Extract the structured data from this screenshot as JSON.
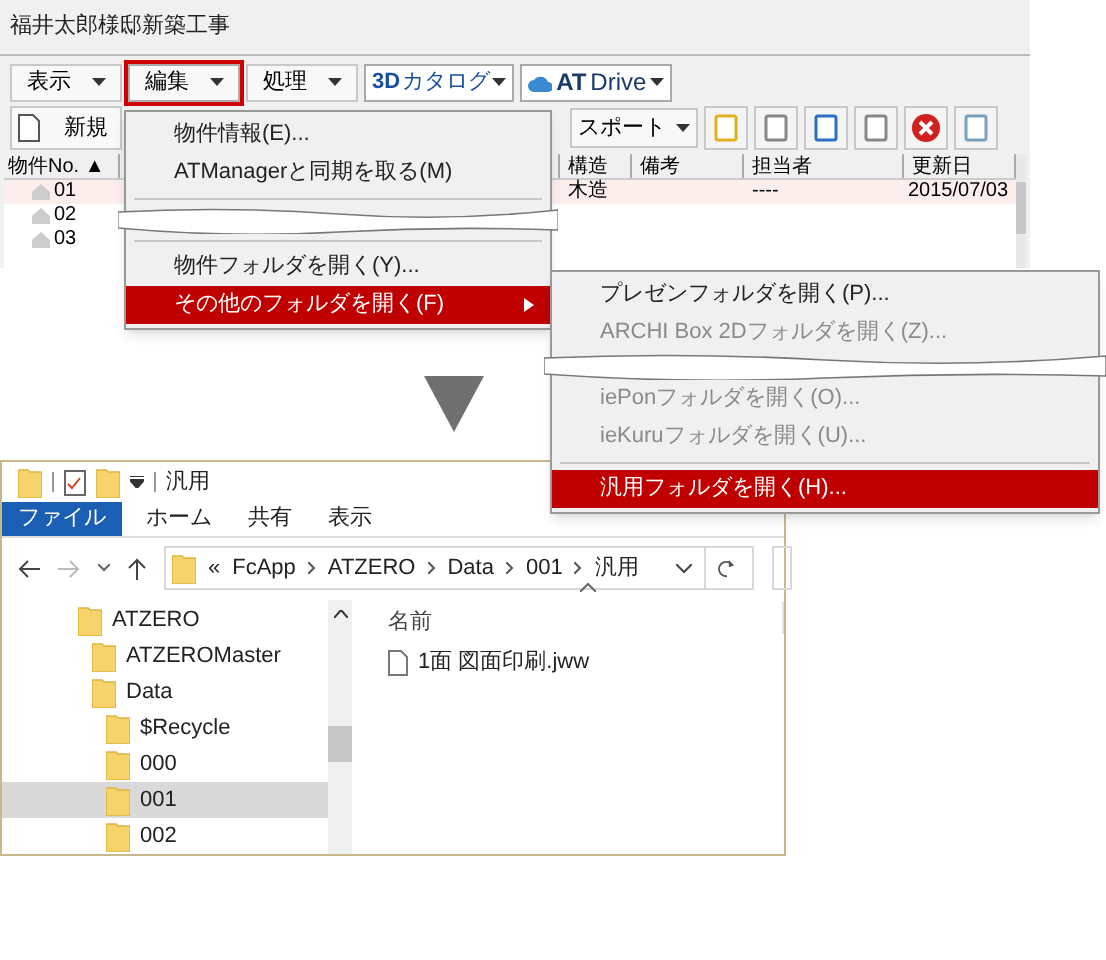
{
  "app": {
    "title": "福井太郎様邸新築工事",
    "menu_bar": [
      {
        "label": "表示",
        "selected": false
      },
      {
        "label": "編集",
        "selected": true
      },
      {
        "label": "処理",
        "selected": false
      }
    ],
    "catalog_button": {
      "logo": "3D",
      "label": "カタログ"
    },
    "drive_button": {
      "logo": "AT",
      "label": "Drive"
    },
    "new_button": "新規",
    "export_button": "スポート",
    "table": {
      "columns": [
        "物件No. ▲",
        "構造",
        "備考",
        "担当者",
        "更新日"
      ],
      "rows": [
        {
          "no": "01",
          "structure": "木造",
          "person": "----",
          "date": "2015/07/03",
          "selected": true
        },
        {
          "no": "02",
          "selected": false
        },
        {
          "no": "03",
          "selected": false
        }
      ]
    }
  },
  "edit_menu": [
    {
      "kind": "item",
      "label": "物件情報(E)...",
      "selected": false
    },
    {
      "kind": "item",
      "label": "ATManagerと同期を取る(M)",
      "selected": false
    },
    {
      "kind": "separator"
    },
    {
      "kind": "break"
    },
    {
      "kind": "separator"
    },
    {
      "kind": "item",
      "label": "物件フォルダを開く(Y)...",
      "selected": false
    },
    {
      "kind": "submenu",
      "label": "その他のフォルダを開く(F)",
      "selected": true
    }
  ],
  "folder_submenu": [
    {
      "kind": "item",
      "label": "プレゼンフォルダを開く(P)...",
      "disabled": false,
      "selected": false
    },
    {
      "kind": "item",
      "label": "ARCHI Box 2Dフォルダを開く(Z)...",
      "disabled": true,
      "selected": false
    },
    {
      "kind": "break"
    },
    {
      "kind": "item",
      "label": "iePonフォルダを開く(O)...",
      "disabled": true,
      "selected": false
    },
    {
      "kind": "item",
      "label": "ieKuruフォルダを開く(U)...",
      "disabled": true,
      "selected": false
    },
    {
      "kind": "separator"
    },
    {
      "kind": "item",
      "label": "汎用フォルダを開く(H)...",
      "disabled": false,
      "selected": true
    }
  ],
  "explorer": {
    "title": "汎用",
    "ribbon_tabs": [
      {
        "label": "ファイル",
        "selected": true
      },
      {
        "label": "ホーム",
        "selected": false
      },
      {
        "label": "共有",
        "selected": false
      },
      {
        "label": "表示",
        "selected": false
      }
    ],
    "address": [
      "«",
      "FcApp",
      "ATZERO",
      "Data",
      "001",
      "汎用"
    ],
    "tree": [
      {
        "label": "ATZERO",
        "selected": false,
        "children": [
          {
            "label": "ATZEROMaster",
            "selected": false
          },
          {
            "label": "Data",
            "selected": false,
            "children": [
              {
                "label": "$Recycle",
                "selected": false
              },
              {
                "label": "000",
                "selected": false
              },
              {
                "label": "001",
                "selected": true
              },
              {
                "label": "002",
                "selected": false
              }
            ]
          }
        ]
      }
    ],
    "column_header": "名前",
    "files": [
      "1面 図面印刷.jww"
    ]
  }
}
